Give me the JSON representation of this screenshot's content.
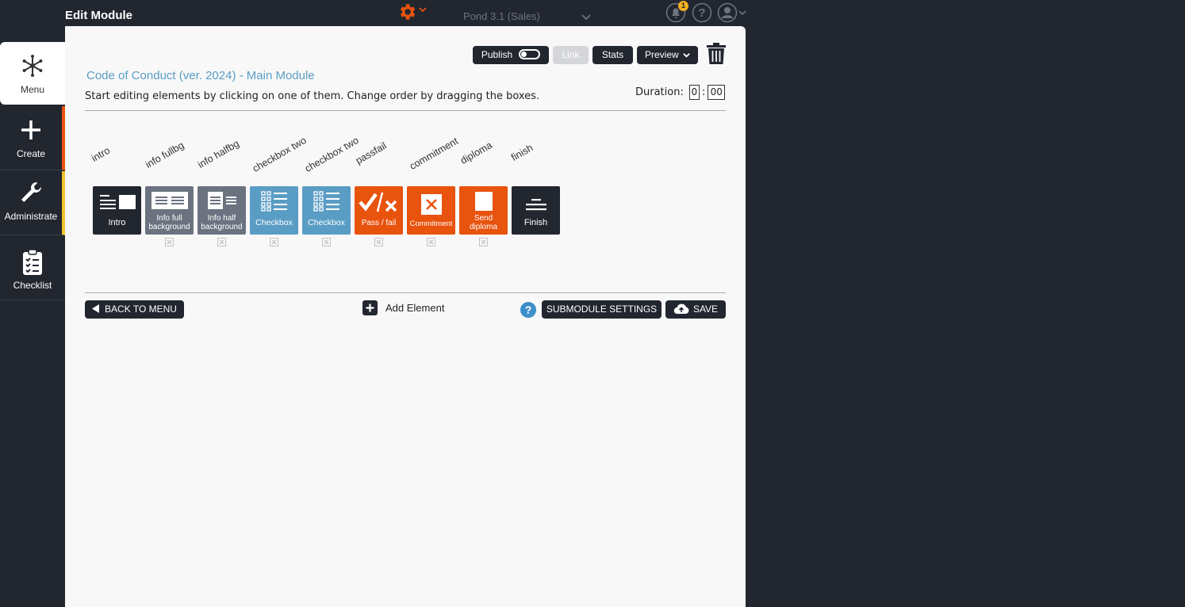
{
  "header": {
    "title": "Edit Module",
    "org": "Pond 3.1 (Sales)",
    "notification_count": "1"
  },
  "sidebar": {
    "items": [
      {
        "label": "Menu",
        "icon": "snowflake-icon"
      },
      {
        "label": "Create",
        "icon": "plus-icon"
      },
      {
        "label": "Administrate",
        "icon": "wrench-icon"
      },
      {
        "label": "Checklist",
        "icon": "clipboard-icon"
      }
    ]
  },
  "toolbar": {
    "publish": "Publish",
    "link": "Link",
    "stats": "Stats",
    "preview": "Preview"
  },
  "module": {
    "title": "Code of Conduct (ver. 2024) - Main Module",
    "instructions": "Start editing elements by clicking on one of them. Change order by dragging the boxes.",
    "duration_label": "Duration:",
    "duration_hours": "0",
    "duration_minutes": "00"
  },
  "elements": [
    {
      "label": "intro",
      "caption": "Intro",
      "color": "#22262f",
      "icon": "intro-icon"
    },
    {
      "label": "info fullbg",
      "caption": "Info full background",
      "color": "#6b7280",
      "icon": "info-full-icon"
    },
    {
      "label": "info halfbg",
      "caption": "Info half background",
      "color": "#6b7280",
      "icon": "info-half-icon"
    },
    {
      "label": "checkbox two",
      "caption": "Checkbox",
      "color": "#5a9dc4",
      "icon": "checkbox-icon"
    },
    {
      "label": "checkbox two",
      "caption": "Checkbox",
      "color": "#5a9dc4",
      "icon": "checkbox-icon"
    },
    {
      "label": "passfail",
      "caption": "Pass / fail",
      "color": "#e8530e",
      "icon": "pass-fail-icon"
    },
    {
      "label": "commitment",
      "caption": "Commitment",
      "color": "#e8530e",
      "icon": "commitment-icon"
    },
    {
      "label": "diploma",
      "caption": "Send diploma",
      "color": "#e8530e",
      "icon": "diploma-icon"
    },
    {
      "label": "finish",
      "caption": "Finish",
      "color": "#22262f",
      "icon": "finish-icon"
    }
  ],
  "footer": {
    "back": "BACK TO MENU",
    "add_element": "Add Element",
    "help": "?",
    "submodule_settings": "SUBMODULE SETTINGS",
    "save": "SAVE"
  }
}
